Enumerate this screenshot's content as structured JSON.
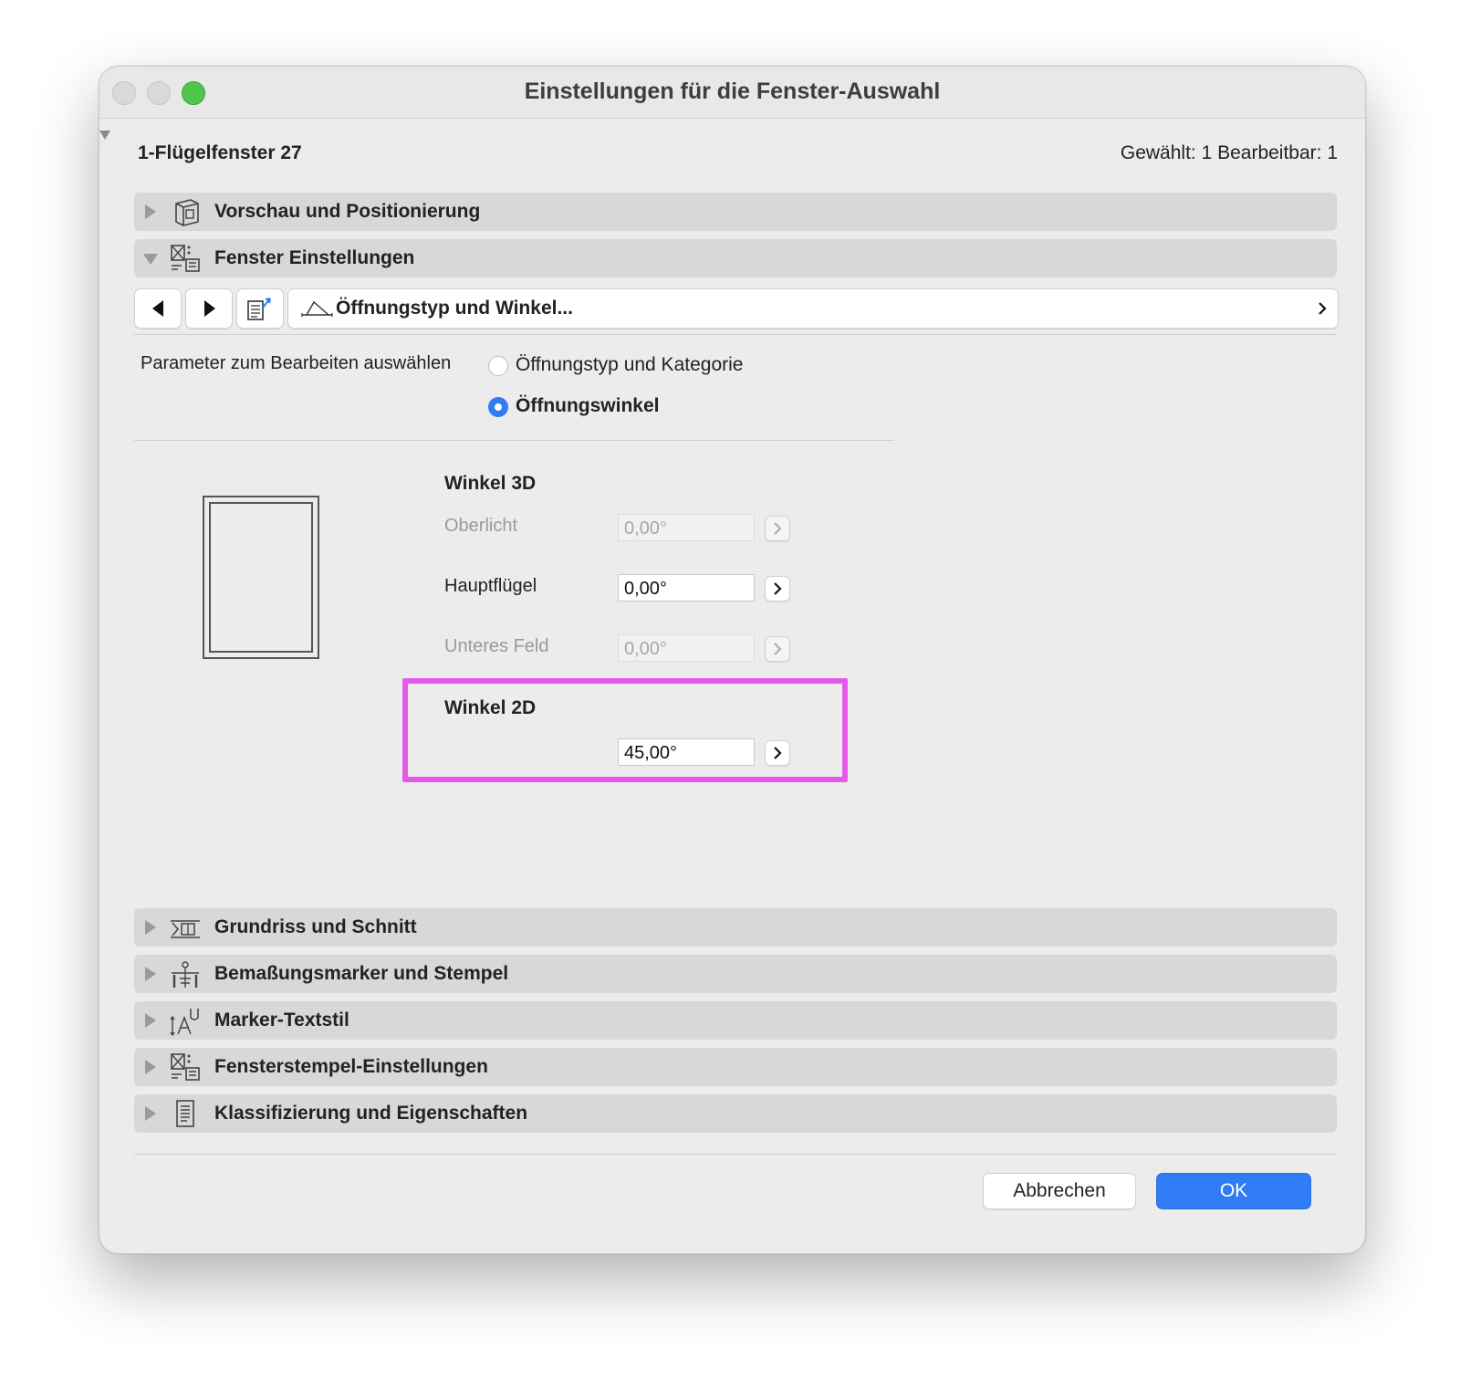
{
  "window": {
    "title": "Einstellungen für die Fenster-Auswahl"
  },
  "header": {
    "element_name": "1-Flügelfenster 27",
    "selection_info": "Gewählt: 1 Bearbeitbar: 1"
  },
  "panels_top": [
    {
      "label": "Vorschau und Positionierung",
      "icon": "cube-preview-icon",
      "expanded": false
    },
    {
      "label": "Fenster Einstellungen",
      "icon": "window-settings-icon",
      "expanded": true
    }
  ],
  "nav": {
    "page_label": "Öffnungstyp und Winkel...",
    "page_icon": "opening-angle-icon"
  },
  "params": {
    "label": "Parameter zum Bearbeiten auswählen",
    "options": [
      {
        "label": "Öffnungstyp und Kategorie",
        "selected": false
      },
      {
        "label": "Öffnungswinkel",
        "selected": true
      }
    ]
  },
  "angle3d": {
    "title": "Winkel 3D",
    "fields": [
      {
        "label": "Oberlicht",
        "value": "0,00°",
        "enabled": false
      },
      {
        "label": "Hauptflügel",
        "value": "0,00°",
        "enabled": true
      },
      {
        "label": "Unteres Feld",
        "value": "0,00°",
        "enabled": false
      }
    ]
  },
  "angle2d": {
    "title": "Winkel 2D",
    "value": "45,00°"
  },
  "panels_bottom": [
    {
      "label": "Grundriss und Schnitt",
      "icon": "floorplan-section-icon"
    },
    {
      "label": "Bemaßungsmarker und Stempel",
      "icon": "dimension-marker-icon"
    },
    {
      "label": "Marker-Textstil",
      "icon": "text-style-icon"
    },
    {
      "label": "Fensterstempel-Einstellungen",
      "icon": "window-stamp-icon"
    },
    {
      "label": "Klassifizierung und Eigenschaften",
      "icon": "document-list-icon"
    }
  ],
  "buttons": {
    "cancel": "Abbrechen",
    "ok": "OK"
  },
  "colors": {
    "accent": "#2f7cf6",
    "highlight": "#e35be8",
    "window_bg": "#ececec"
  }
}
